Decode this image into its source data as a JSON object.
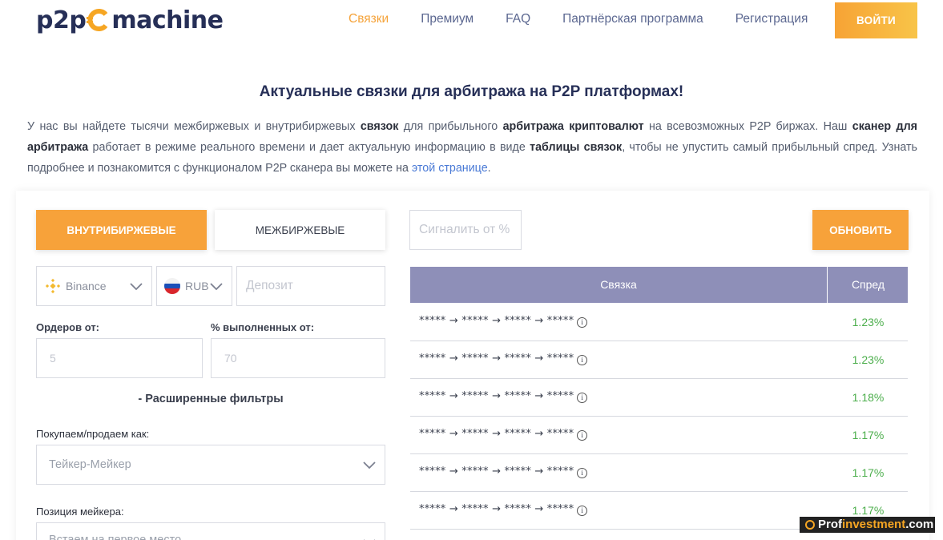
{
  "brand": {
    "prefix": "p2p",
    "suffix": "machine"
  },
  "nav": {
    "items": [
      "Связки",
      "Премиум",
      "FAQ",
      "Партнёрская программа",
      "Регистрация"
    ],
    "active_index": 0,
    "login_label": "войти"
  },
  "colors": {
    "accent": "#f7a23a",
    "table_header": "#8e8fb8",
    "spread_green": "#4cae4c",
    "brand_navy": "#262f57"
  },
  "intro": {
    "title": "Актуальные связки для арбитража на P2P платформах!",
    "p1": "У нас вы найдете тысячи межбиржевых и внутрибиржевых ",
    "b1": "связок",
    "p2": " для прибыльного ",
    "b2": "арбитража криптовалют",
    "p3": " на всевозможных P2P биржах. Наш ",
    "b3": "сканер для арбитража",
    "p4": " работает в режиме реального времени и дает актуальную информацию в виде ",
    "b4": "таблицы связок",
    "p5": ", чтобы не упустить самый прибыльный спред. Узнать подробнее и познакомится с функционалом P2P сканера вы можете на ",
    "link": "этой странице",
    "p6": "."
  },
  "filters": {
    "tab_intra": "внутрибиржевые",
    "tab_inter": "межбиржевые",
    "exchange": {
      "value": "Binance",
      "icon": "binance-icon"
    },
    "currency": {
      "value": "RUB",
      "icon": "russia-flag-icon"
    },
    "deposit_placeholder": "Депозит",
    "orders_label": "Ордеров от:",
    "orders_placeholder": "5",
    "completed_label": "% выполненных от:",
    "completed_placeholder": "70",
    "advanced_toggle": "- Расширенные фильтры",
    "buy_sell_label": "Покупаем/продаем как:",
    "buy_sell_value": "Тейкер-Мейкер",
    "maker_position_label": "Позиция мейкера:",
    "maker_position_value": "Встаем на первое место"
  },
  "controls": {
    "signal_placeholder": "Сигналить от %",
    "refresh_label": "обновить"
  },
  "table": {
    "col_bundle": "Связка",
    "col_spread": "Спред",
    "rows": [
      {
        "path": "***** → ***** → ***** → *****",
        "spread": "1.23%"
      },
      {
        "path": "***** → ***** → ***** → *****",
        "spread": "1.23%"
      },
      {
        "path": "***** → ***** → ***** → *****",
        "spread": "1.18%"
      },
      {
        "path": "***** → ***** → ***** → *****",
        "spread": "1.17%"
      },
      {
        "path": "***** → ***** → ***** → *****",
        "spread": "1.17%"
      },
      {
        "path": "***** → ***** → ***** → *****",
        "spread": "1.17%"
      }
    ]
  },
  "watermark": {
    "a": "Prof",
    "b": "investment",
    "c": ".com"
  }
}
